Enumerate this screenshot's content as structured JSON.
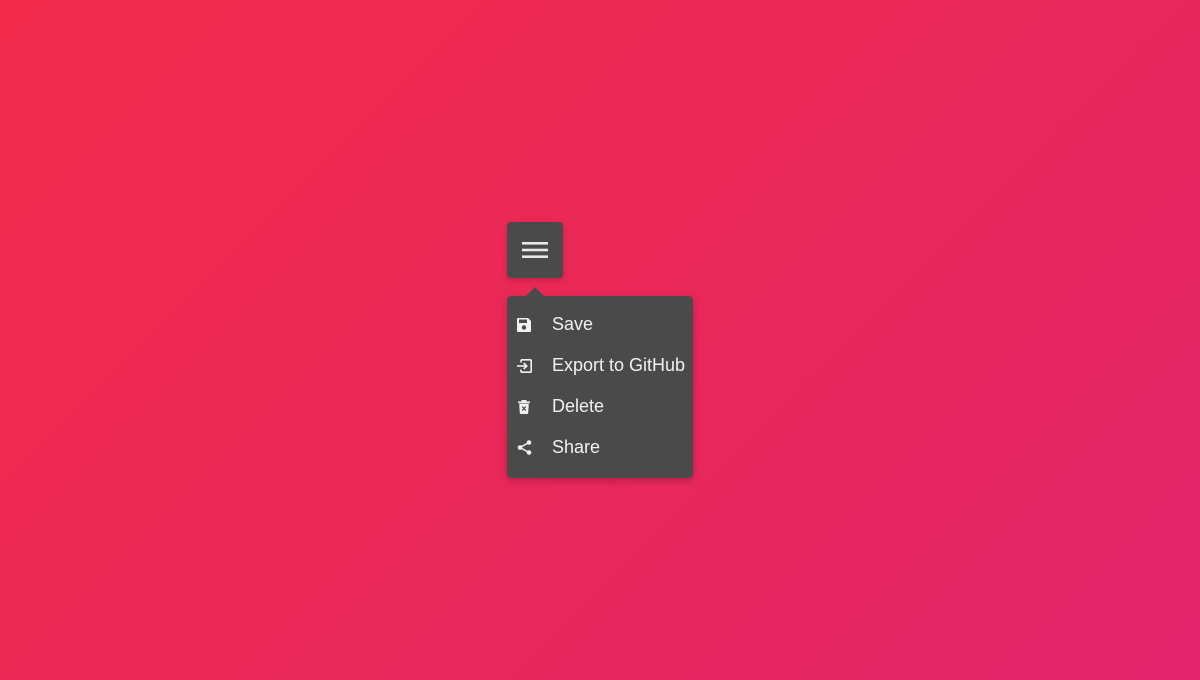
{
  "toggle": {
    "icon": "hamburger-menu-icon"
  },
  "menu": {
    "items": [
      {
        "label": "Save",
        "icon": "floppy-disk-icon"
      },
      {
        "label": "Export to GitHub",
        "icon": "export-icon"
      },
      {
        "label": "Delete",
        "icon": "trash-icon"
      },
      {
        "label": "Share",
        "icon": "share-icon"
      }
    ]
  },
  "colors": {
    "background_start": "#f22b4c",
    "background_end": "#e2246b",
    "menu_background": "#4a4a4a",
    "menu_text": "#f1f1f1"
  }
}
